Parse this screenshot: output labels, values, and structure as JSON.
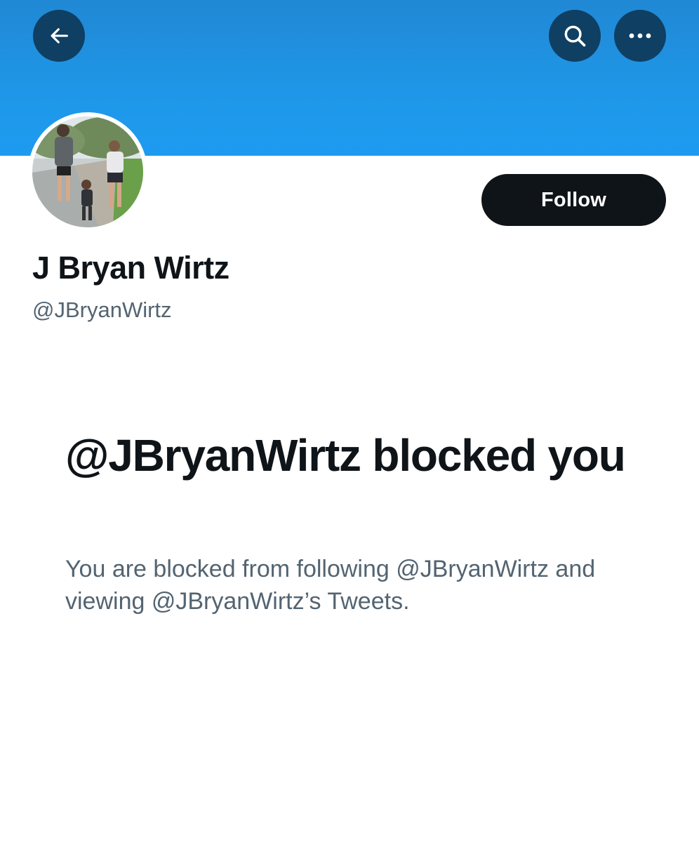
{
  "header": {
    "back_icon": "arrow-left-icon",
    "search_icon": "search-icon",
    "more_icon": "more-horizontal-icon",
    "banner_color": "#1d9bf0",
    "button_color": "#0f3f62"
  },
  "profile": {
    "avatar_icon": "profile-photo",
    "display_name": "J Bryan Wirtz",
    "handle": "@JBryanWirtz",
    "follow_label": "Follow"
  },
  "blocked": {
    "title": "@JBryanWirtz blocked you",
    "description": "You are blocked from following @JBryanWirtz and viewing @JBryanWirtz’s Tweets."
  }
}
